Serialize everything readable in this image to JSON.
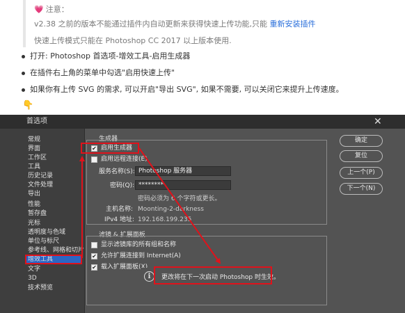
{
  "doc": {
    "note_title": "注意：",
    "note_line1": "v2.38 之前的版本不能通过插件内自动更新来获得快速上传功能,只能",
    "note_link": "重新安装插件",
    "note_line2": "快速上传模式只能在 Photoshop CC 2017 以上版本使用.",
    "steps": [
      "打开: Photoshop 首选项-增效工具-启用生成器",
      "在插件右上角的菜单中勾选\"启用快速上传\"",
      "如果你有上传 SVG 的需求, 可以开启\"导出 SVG\", 如果不需要, 可以关闭它来提升上传速度。"
    ],
    "pointer_emoji": "👇"
  },
  "dialog": {
    "title": "首选项",
    "close": "✕",
    "sidebar": [
      "常规",
      "界面",
      "工作区",
      "工具",
      "历史记录",
      "文件处理",
      "导出",
      "性能",
      "暂存盘",
      "光标",
      "透明度与色域",
      "单位与标尺",
      "参考线、网格和切片",
      "增效工具",
      "文字",
      "3D",
      "技术预览"
    ],
    "selected_index": 13,
    "generator": {
      "section": "生成器",
      "enable": "启用生成器",
      "remote": "启用远程连接(E)",
      "service_label": "服务名称(S):",
      "service_value": "Photoshop 服务器",
      "password_label": "密码(Q):",
      "password_value": "********",
      "password_hint": "密码必须为 6 个字符或更长。",
      "hostname_label": "主机名称:",
      "hostname_value": "Moonting-2-darkness",
      "ip_label": "IPv4 地址:",
      "ip_value": "192.168.199.235"
    },
    "filters": {
      "section": "滤镜 & 扩展面板",
      "show_all": "显示滤镜库的所有组和名称",
      "allow_internet": "允许扩展连接到 Internet(A)",
      "load_panels": "载入扩展面板(X)"
    },
    "notice": "更改将在下一次启动 Photoshop 时生效。",
    "notice_icon": "i",
    "buttons": {
      "ok": "确定",
      "reset": "复位",
      "prev": "上一个(P)",
      "next": "下一个(N)"
    },
    "highlight_color": "#e0121b",
    "selection_color": "#2b66c4"
  }
}
